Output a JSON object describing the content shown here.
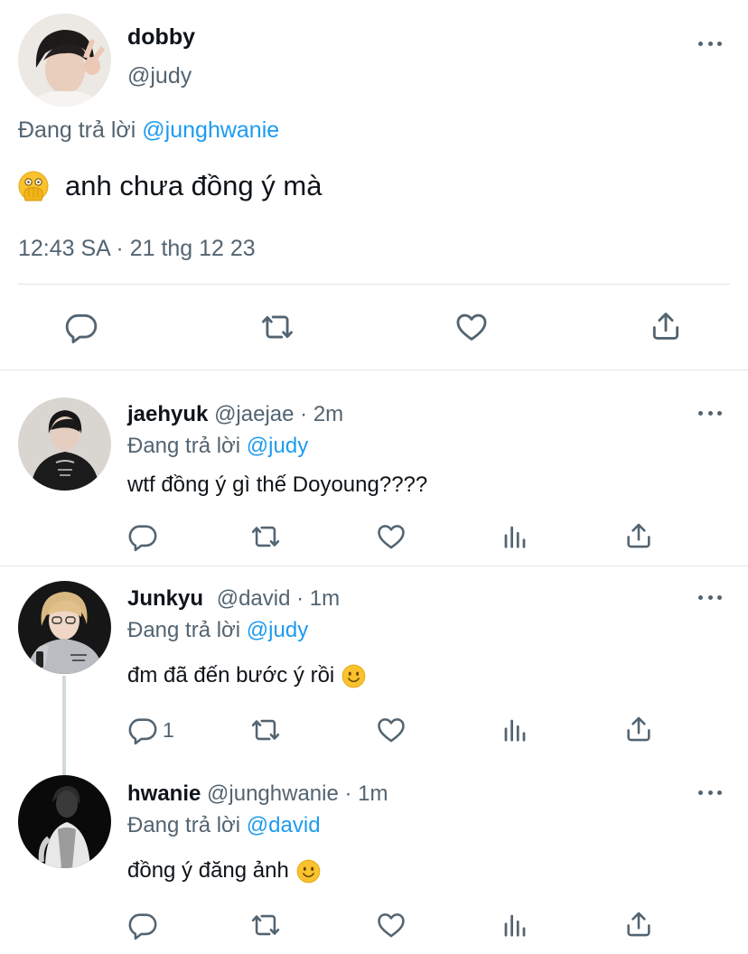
{
  "main_tweet": {
    "display_name": "dobby",
    "handle": "@judy",
    "reply_prefix": "Đang trả lời",
    "reply_to": "@junghwanie",
    "text": "anh chưa đồng ý mà",
    "emoji": "face-with-open-eyes-and-hand-over-mouth",
    "timestamp": "12:43 SA · 21 thg 12 23"
  },
  "replies": [
    {
      "display_name": "jaehyuk",
      "handle": "@jaejae",
      "time": "· 2m",
      "reply_prefix": "Đang trả lời",
      "reply_to": "@judy",
      "text": "wtf đồng ý gì thế Doyoung????"
    },
    {
      "display_name": "Junkyu",
      "handle": "@david",
      "time": "· 1m",
      "reply_prefix": "Đang trả lời",
      "reply_to": "@judy",
      "text": "đm đã đến bước ý rồi",
      "emoji": "slightly-smiling-face",
      "reply_count": "1"
    },
    {
      "display_name": "hwanie",
      "handle": "@junghwanie",
      "time": "· 1m",
      "reply_prefix": "Đang trả lời",
      "reply_to": "@david",
      "text": "đồng ý đăng ảnh",
      "emoji": "slightly-smiling-face"
    }
  ],
  "colors": {
    "accent": "#1d9bf0",
    "icon_grey": "#536471",
    "text": "#0f1419",
    "divider": "#e1e4e6"
  }
}
